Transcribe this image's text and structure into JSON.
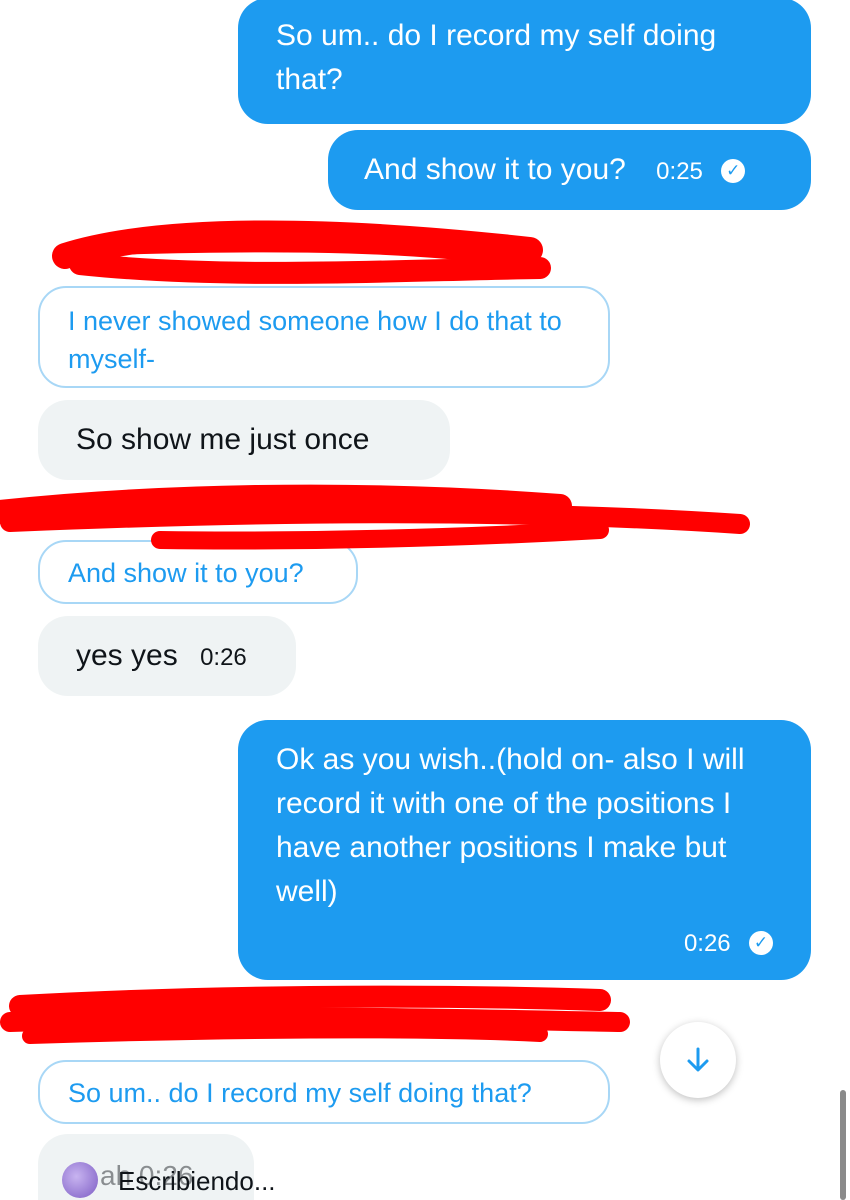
{
  "messages": {
    "m1": {
      "text": "So um.. do I record my self doing that?"
    },
    "m2": {
      "text": "And show it to you?",
      "time": "0:25"
    },
    "q1": {
      "text": "I never showed someone how I do that to myself-"
    },
    "m3": {
      "text": "So show me just once"
    },
    "q2": {
      "text": "And show it to you?"
    },
    "m4": {
      "text": "yes yes",
      "time": "0:26"
    },
    "m5": {
      "text": "Ok as you wish..(hold on- also I will record it with one of the positions I have another positions I make but well)",
      "time": "0:26"
    },
    "q3": {
      "text": "So um.. do I record my self doing that?"
    }
  },
  "typing": {
    "partial": "ah   0:26",
    "text": "Escribiendo..."
  },
  "icons": {
    "read_receipt": "check-circle-icon",
    "scroll_down": "arrow-down-icon"
  },
  "colors": {
    "accent": "#1d9bf0",
    "received_bg": "#eff3f4",
    "redaction": "#ff0000"
  }
}
